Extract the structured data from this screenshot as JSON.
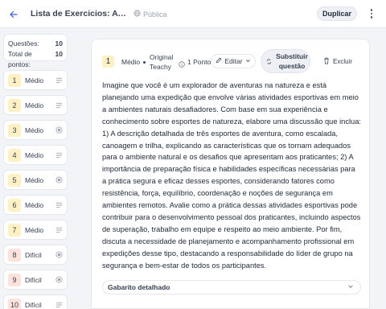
{
  "header": {
    "title": "Lista de Exercicios: Avaliação...",
    "visibility": "Pública",
    "duplicate_label": "Duplicar"
  },
  "summary": {
    "questions_label": "Questões:",
    "questions_value": "10",
    "points_label": "Total de pontos:",
    "points_value": "10"
  },
  "questions": [
    {
      "number": "1",
      "level": "Médio",
      "icon": "lines-icon"
    },
    {
      "number": "2",
      "level": "Médio",
      "icon": "lines-icon"
    },
    {
      "number": "3",
      "level": "Médio",
      "icon": "radio-icon"
    },
    {
      "number": "4",
      "level": "Médio",
      "icon": "lines-icon"
    },
    {
      "number": "5",
      "level": "Médio",
      "icon": "radio-icon"
    },
    {
      "number": "6",
      "level": "Médio",
      "icon": "lines-icon"
    },
    {
      "number": "7",
      "level": "Médio",
      "icon": "lines-icon"
    },
    {
      "number": "8",
      "level": "Difícil",
      "icon": "radio-icon"
    },
    {
      "number": "9",
      "level": "Difícil",
      "icon": "radio-icon"
    },
    {
      "number": "10",
      "level": "Difícil",
      "icon": "lines-icon"
    }
  ],
  "main": {
    "number": "1",
    "level": "Médio",
    "source": "Original Teachy",
    "points": "1 Ponto",
    "edit_label": "Editar",
    "swap_label": "Substituir questão",
    "delete_label": "Excluir",
    "body": "Imagine que você é um explorador de aventuras na natureza e está planejando uma expedição que envolve várias atividades esportivas em meio a ambientes naturais desafiadores. Com base em sua experiência e conhecimento sobre esportes de natureza, elabore uma discussão que inclua: 1) A descrição detalhada de três esportes de aventura, como escalada, canoagem e trilha, explicando as características que os tornam adequados para o ambiente natural e os desafios que apresentam aos praticantes; 2) A importância de preparação física e habilidades específicas necessárias para a prática segura e eficaz desses esportes, considerando fatores como resistência, força, equilíbrio, coordenação e noções de segurança em ambientes remotos. Avalie como a prática dessas atividades esportivas pode contribuir para o desenvolvimento pessoal dos praticantes, incluindo aspectos de superação, trabalho em equipe e respeito ao meio ambiente. Por fim, discuta a necessidade de planejamento e acompanhamento profissional em expedições desse tipo, destacando a responsabilidade do líder de grupo na segurança e bem-estar de todos os participantes.",
    "answer_label": "Gabarito detalhado"
  },
  "colors": {
    "medium_badge": "#fff1c4",
    "hard_badge": "#fde2dc",
    "accent": "#3b5bdb"
  }
}
